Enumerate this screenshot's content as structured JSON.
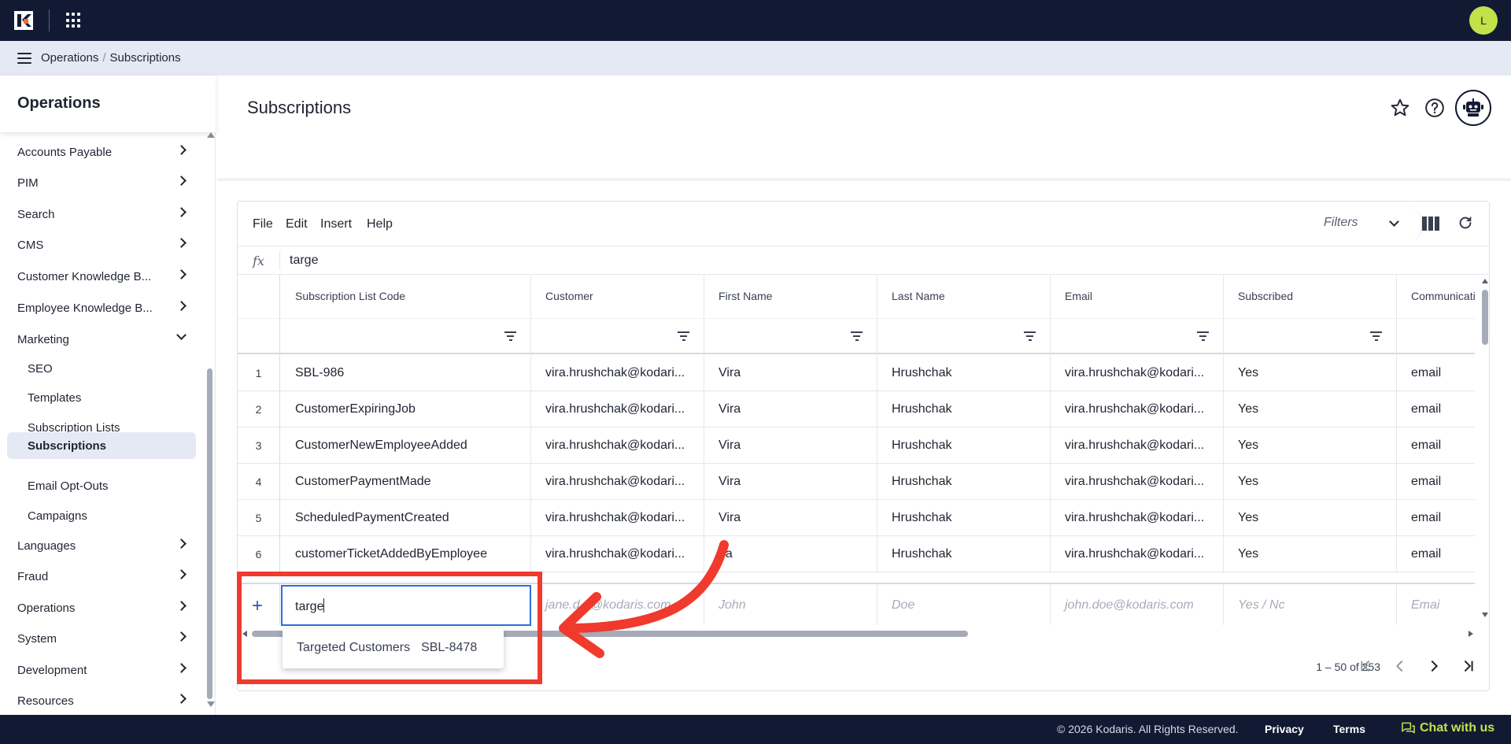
{
  "topbar": {
    "avatar_initial": "L",
    "colors": {
      "bg": "#121a33",
      "avatar": "#c2e24a",
      "logo_accent": "#f26a2e"
    }
  },
  "breadcrumb": {
    "items": [
      "Operations",
      "Subscriptions"
    ],
    "separator": "/"
  },
  "sidebar": {
    "title": "Operations",
    "items": [
      {
        "label": "Accounts Payable",
        "chevron": "right"
      },
      {
        "label": "PIM",
        "chevron": "right"
      },
      {
        "label": "Search",
        "chevron": "right"
      },
      {
        "label": "CMS",
        "chevron": "right"
      },
      {
        "label": "Customer Knowledge B...",
        "chevron": "right"
      },
      {
        "label": "Employee Knowledge B...",
        "chevron": "right"
      },
      {
        "label": "Marketing",
        "chevron": "down"
      },
      {
        "label": "Languages",
        "chevron": "right"
      },
      {
        "label": "Fraud",
        "chevron": "right"
      },
      {
        "label": "Operations",
        "chevron": "right"
      },
      {
        "label": "System",
        "chevron": "right"
      },
      {
        "label": "Development",
        "chevron": "right"
      },
      {
        "label": "Resources",
        "chevron": "right"
      }
    ],
    "marketing_children": [
      "SEO",
      "Templates",
      "Subscription Lists",
      "Subscriptions",
      "Email Opt-Outs",
      "Campaigns"
    ],
    "active_child": "Subscriptions"
  },
  "page": {
    "title": "Subscriptions",
    "icons": [
      "star-icon",
      "help-icon",
      "bot-icon"
    ]
  },
  "toolbar": {
    "menus": [
      "File",
      "Edit",
      "Insert",
      "Help"
    ],
    "filters_label": "Filters",
    "icons": [
      "columns-icon",
      "refresh-icon"
    ]
  },
  "formula_bar": {
    "label": "fx",
    "value": "targe"
  },
  "grid": {
    "columns": [
      "Subscription List Code",
      "Customer",
      "First Name",
      "Last Name",
      "Email",
      "Subscribed",
      "Communicatio"
    ],
    "rows": [
      {
        "num": "1",
        "cells": [
          "SBL-986",
          "vira.hrushchak@kodari...",
          "Vira",
          "Hrushchak",
          "vira.hrushchak@kodari...",
          "Yes",
          "email"
        ]
      },
      {
        "num": "2",
        "cells": [
          "CustomerExpiringJob",
          "vira.hrushchak@kodari...",
          "Vira",
          "Hrushchak",
          "vira.hrushchak@kodari...",
          "Yes",
          "email"
        ]
      },
      {
        "num": "3",
        "cells": [
          "CustomerNewEmployeeAdded",
          "vira.hrushchak@kodari...",
          "Vira",
          "Hrushchak",
          "vira.hrushchak@kodari...",
          "Yes",
          "email"
        ]
      },
      {
        "num": "4",
        "cells": [
          "CustomerPaymentMade",
          "vira.hrushchak@kodari...",
          "Vira",
          "Hrushchak",
          "vira.hrushchak@kodari...",
          "Yes",
          "email"
        ]
      },
      {
        "num": "5",
        "cells": [
          "ScheduledPaymentCreated",
          "vira.hrushchak@kodari...",
          "Vira",
          "Hrushchak",
          "vira.hrushchak@kodari...",
          "Yes",
          "email"
        ]
      },
      {
        "num": "6",
        "cells": [
          "customerTicketAddedByEmployee",
          "vira.hrushchak@kodari...",
          "ira",
          "Hrushchak",
          "vira.hrushchak@kodari...",
          "Yes",
          "email"
        ]
      }
    ],
    "new_row": {
      "input_value": "targe",
      "placeholders": [
        "",
        "jane.d e@kodaris.com",
        "John",
        "Doe",
        "john.doe@kodaris.com",
        "Yes / Nc",
        "Emai"
      ]
    },
    "suggestion": {
      "name": "Targeted Customers",
      "code": "SBL-8478"
    },
    "pagination": {
      "range_text": "1 – 50 of 253"
    }
  },
  "footer": {
    "copyright": "© 2026 Kodaris. All Rights Reserved.",
    "links": [
      "Privacy",
      "Terms"
    ],
    "chat_label": "Chat with us"
  },
  "annotation": {
    "color": "#f03a2e"
  }
}
